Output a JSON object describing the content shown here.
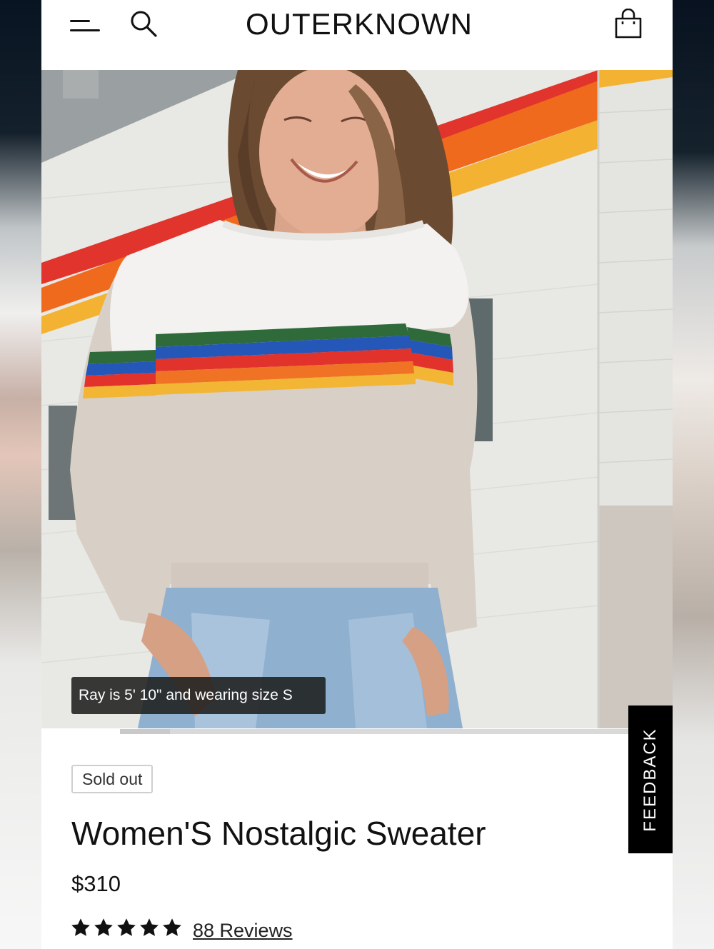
{
  "header": {
    "brand": "OUTERKNOWN",
    "icons": [
      "menu-icon",
      "search-icon",
      "shopping-bag-icon"
    ]
  },
  "hero": {
    "caption": "Ray is 5' 10\" and wearing size S",
    "gallery_progress": 0.09
  },
  "feedback": {
    "label": "FEEDBACK"
  },
  "product": {
    "badge": "Sold out",
    "title": "Women'S Nostalgic Sweater",
    "price": "$310",
    "rating": 5,
    "reviews_label": "88 Reviews"
  },
  "colors": {
    "text": "#111111",
    "feedback_bg": "#000000",
    "badge_border": "#cfcfcf",
    "stripe_red": "#e0342c",
    "stripe_orange": "#f06a1e",
    "stripe_yellow": "#f3b231"
  }
}
